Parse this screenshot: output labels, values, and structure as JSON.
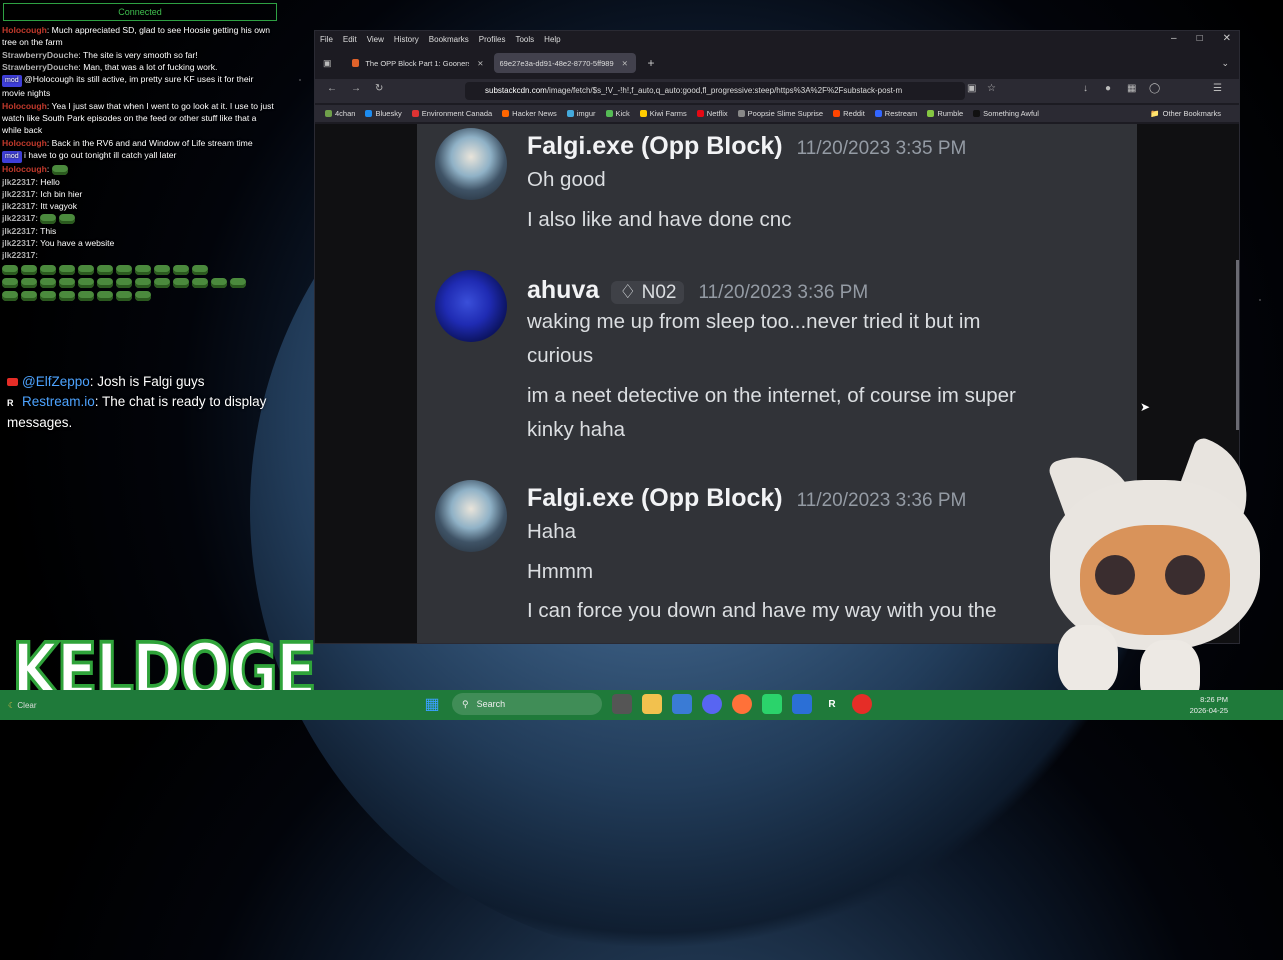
{
  "chat": {
    "status": "Connected",
    "lines": [
      {
        "user": "Holocough",
        "color": "red",
        "text": "Much appreciated SD, glad to see Hoosie getting his own tree on the farm"
      },
      {
        "user": "StrawberryDouche",
        "color": "gray",
        "text": "The site is very smooth so far!"
      },
      {
        "user": "StrawberryDouche",
        "color": "gray",
        "text": "Man, that was a lot of fucking work."
      },
      {
        "user": "",
        "badge": "mod",
        "color": "gray",
        "text": "@Holocough its still active, im pretty sure KF uses it for their movie nights"
      },
      {
        "user": "Holocough",
        "color": "red",
        "text": "Yea I just saw that when I went to go look at it.  I use to just watch like South Park episodes on the feed or other stuff like that a while back"
      },
      {
        "user": "Holocough",
        "color": "red",
        "text": "Back in the RV6 and and Window of Life stream time"
      },
      {
        "user": "",
        "badge": "mod",
        "color": "gray",
        "text": "i have to go out tonight ill catch yall later"
      },
      {
        "user": "Holocough",
        "color": "red",
        "text": ""
      },
      {
        "user": "jlk22317",
        "color": "gray",
        "text": "Hello"
      },
      {
        "user": "jlk22317",
        "color": "gray",
        "text": "Ich bin hier"
      },
      {
        "user": "jlk22317",
        "color": "gray",
        "text": "Itt vagyok"
      },
      {
        "user": "jlk22317",
        "color": "gray",
        "text": ""
      },
      {
        "user": "jlk22317",
        "color": "gray",
        "text": "This"
      },
      {
        "user": "jlk22317",
        "color": "gray",
        "text": "You have a website"
      },
      {
        "user": "jlk22317",
        "color": "gray",
        "text": ""
      }
    ],
    "restream": [
      {
        "user": "@ElfZeppo",
        "text": "Josh is Falgi guys"
      },
      {
        "user": "Restream.io",
        "text": "The chat is ready to display messages."
      }
    ],
    "logo_text": "KELDOGE"
  },
  "browser": {
    "menu": [
      "File",
      "Edit",
      "View",
      "History",
      "Bookmarks",
      "Profiles",
      "Tools",
      "Help"
    ],
    "tabs": [
      {
        "label": "The OPP Block Part 1: Gooners",
        "active": false
      },
      {
        "label": "69e27e3a-dd91-48e2-8770-5ff989",
        "active": true
      }
    ],
    "url_host": "substackcdn.com",
    "url_rest": "/image/fetch/$s_!V_-!h!,f_auto,q_auto:good,fl_progressive:steep/https%3A%2F%2Fsubstack-post-m",
    "bookmarks": [
      "4chan",
      "Bluesky",
      "Environment Canada",
      "Hacker News",
      "imgur",
      "Kick",
      "Kiwi Farms",
      "Netflix",
      "Poopsie Slime Suprise",
      "Reddit",
      "Restream",
      "Rumble",
      "Something Awful"
    ],
    "other_bookmarks": "Other Bookmarks",
    "bookmark_colors": [
      "#6fa04a",
      "#1d8cf0",
      "#d33",
      "#f60",
      "#4ad",
      "#5b5",
      "#fc0",
      "#e50914",
      "#888",
      "#ff4500",
      "#36f",
      "#85c742",
      "#111"
    ]
  },
  "discord": {
    "messages": [
      {
        "author": "Falgi.exe (Opp Block)",
        "time": "11/20/2023 3:35 PM",
        "role": "",
        "lines": [
          "Oh good",
          "I also like and have done cnc"
        ]
      },
      {
        "author": "ahuva",
        "time": "11/20/2023 3:36 PM",
        "role": "N02",
        "lines": [
          "waking me up from sleep too...never tried it but im",
          "curious",
          "im a neet detective on the internet, of course im super",
          "kinky haha"
        ]
      },
      {
        "author": "Falgi.exe (Opp Block)",
        "time": "11/20/2023 3:36 PM",
        "role": "",
        "lines": [
          "Haha",
          "Hmmm",
          "I can force you down and have my way with you the"
        ]
      }
    ]
  },
  "taskbar": {
    "weather": "Clear",
    "search": "Search",
    "time": "8:26 PM",
    "date": "2026-04-25"
  }
}
